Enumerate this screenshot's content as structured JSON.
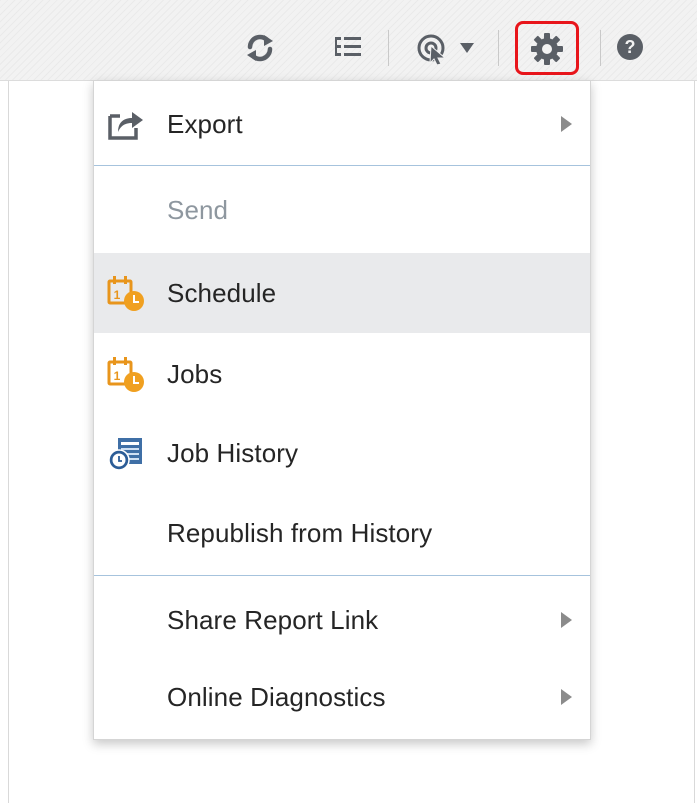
{
  "toolbar": {
    "icons": [
      {
        "name": "refresh-icon"
      },
      {
        "name": "outline-list-icon"
      },
      {
        "name": "actions-menu-icon"
      },
      {
        "name": "settings-gear-icon",
        "highlighted": true
      },
      {
        "name": "help-icon"
      }
    ],
    "highlight_color": "#e8151b"
  },
  "menu": {
    "items": [
      {
        "label": "Export",
        "icon": "export-icon",
        "submenu": true,
        "enabled": true
      },
      {
        "label": "Send",
        "icon": null,
        "submenu": false,
        "enabled": false
      },
      {
        "label": "Schedule",
        "icon": "calendar-clock-icon",
        "submenu": false,
        "enabled": true,
        "hovered": true
      },
      {
        "label": "Jobs",
        "icon": "calendar-clock-icon",
        "submenu": false,
        "enabled": true
      },
      {
        "label": "Job History",
        "icon": "job-history-icon",
        "submenu": false,
        "enabled": true
      },
      {
        "label": "Republish from History",
        "icon": null,
        "submenu": false,
        "enabled": true
      },
      {
        "label": "Share Report Link",
        "icon": null,
        "submenu": true,
        "enabled": true
      },
      {
        "label": "Online Diagnostics",
        "icon": null,
        "submenu": true,
        "enabled": true
      }
    ],
    "hover_color": "#e9eaec",
    "divider_color": "#a6c3dd",
    "disabled_text_color": "#8e979f"
  }
}
